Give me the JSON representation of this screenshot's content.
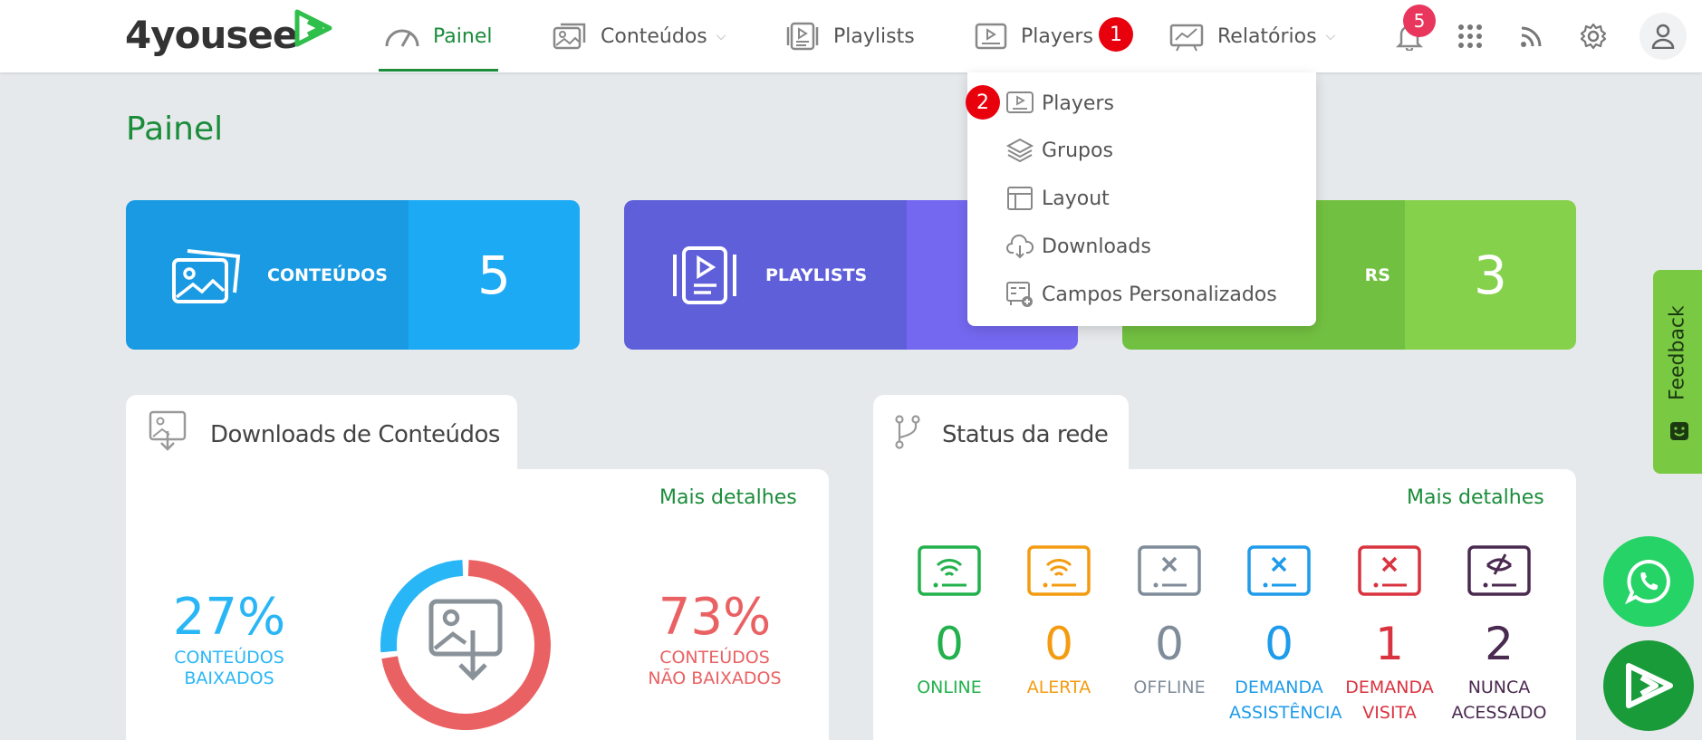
{
  "brand": {
    "name": "4yousee"
  },
  "nav": {
    "items": [
      {
        "label": "Painel"
      },
      {
        "label": "Conteúdos"
      },
      {
        "label": "Playlists"
      },
      {
        "label": "Players"
      },
      {
        "label": "Relatórios"
      }
    ],
    "notifications_count": "5"
  },
  "annotations": {
    "step1": "1",
    "step2": "2"
  },
  "page_title": "Painel",
  "stat_cards": [
    {
      "label": "CONTEÚDOS",
      "value": "5",
      "color_left": "#1a9ae3",
      "color_right": "#1caaf5"
    },
    {
      "label": "PLAYLISTS",
      "value": "",
      "color_left": "#5f5fda",
      "color_right": "#7468f0"
    },
    {
      "label": "PLAYERS",
      "visible_label": "RS",
      "value": "3",
      "color_left": "#72c041",
      "color_right": "#86d14c"
    }
  ],
  "downloads_panel": {
    "title": "Downloads de Conteúdos",
    "more_link": "Mais detalhes",
    "downloaded": {
      "value": "27%",
      "label_line1": "CONTEÚDOS",
      "label_line2": "BAIXADOS"
    },
    "not_downloaded": {
      "value": "73%",
      "label_line1": "CONTEÚDOS",
      "label_line2": "NÃO BAIXADOS"
    },
    "donut": {
      "downloaded_fraction": 0.27,
      "downloaded_color": "#29b6f6",
      "not_downloaded_color": "#ea6163"
    }
  },
  "network_panel": {
    "title": "Status da rede",
    "more_link": "Mais detalhes",
    "statuses": [
      {
        "value": "0",
        "label_line1": "ONLINE",
        "label_line2": "",
        "color": "#22b14c"
      },
      {
        "value": "0",
        "label_line1": "ALERTA",
        "label_line2": "",
        "color": "#f39c12"
      },
      {
        "value": "0",
        "label_line1": "OFFLINE",
        "label_line2": "",
        "color": "#7f8c99"
      },
      {
        "value": "0",
        "label_line1": "DEMANDA",
        "label_line2": "ASSISTÊNCIA",
        "color": "#1e9bea"
      },
      {
        "value": "1",
        "label_line1": "DEMANDA",
        "label_line2": "VISITA",
        "color": "#d9333f"
      },
      {
        "value": "2",
        "label_line1": "NUNCA",
        "label_line2": "ACESSADO",
        "color": "#4a2a50"
      }
    ]
  },
  "players_dropdown": {
    "items": [
      {
        "label": "Players",
        "icon": "player-icon"
      },
      {
        "label": "Grupos",
        "icon": "layers-icon"
      },
      {
        "label": "Layout",
        "icon": "layout-icon"
      },
      {
        "label": "Downloads",
        "icon": "cloud-download-icon"
      },
      {
        "label": "Campos Personalizados",
        "icon": "custom-fields-icon"
      }
    ]
  },
  "feedback": {
    "label": "Feedback"
  },
  "colors": {
    "brand_green": "#1a8c3a",
    "whatsapp": "#25d366"
  }
}
